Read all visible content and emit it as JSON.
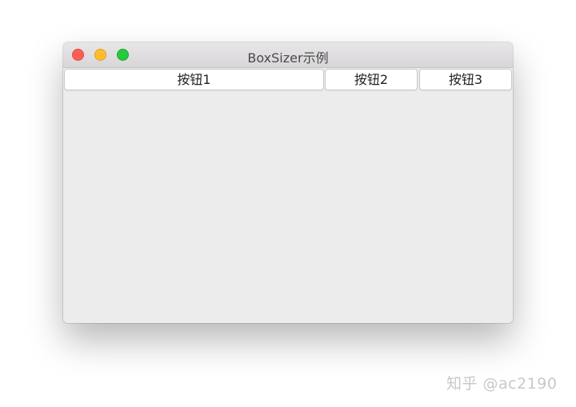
{
  "window": {
    "title": "BoxSizer示例",
    "controls": {
      "close_color": "#fd5f57",
      "minimize_color": "#febc2e",
      "maximize_color": "#28c840"
    }
  },
  "buttons": [
    {
      "label": "按钮1"
    },
    {
      "label": "按钮2"
    },
    {
      "label": "按钮3"
    }
  ],
  "watermark": "知乎 @ac2190"
}
